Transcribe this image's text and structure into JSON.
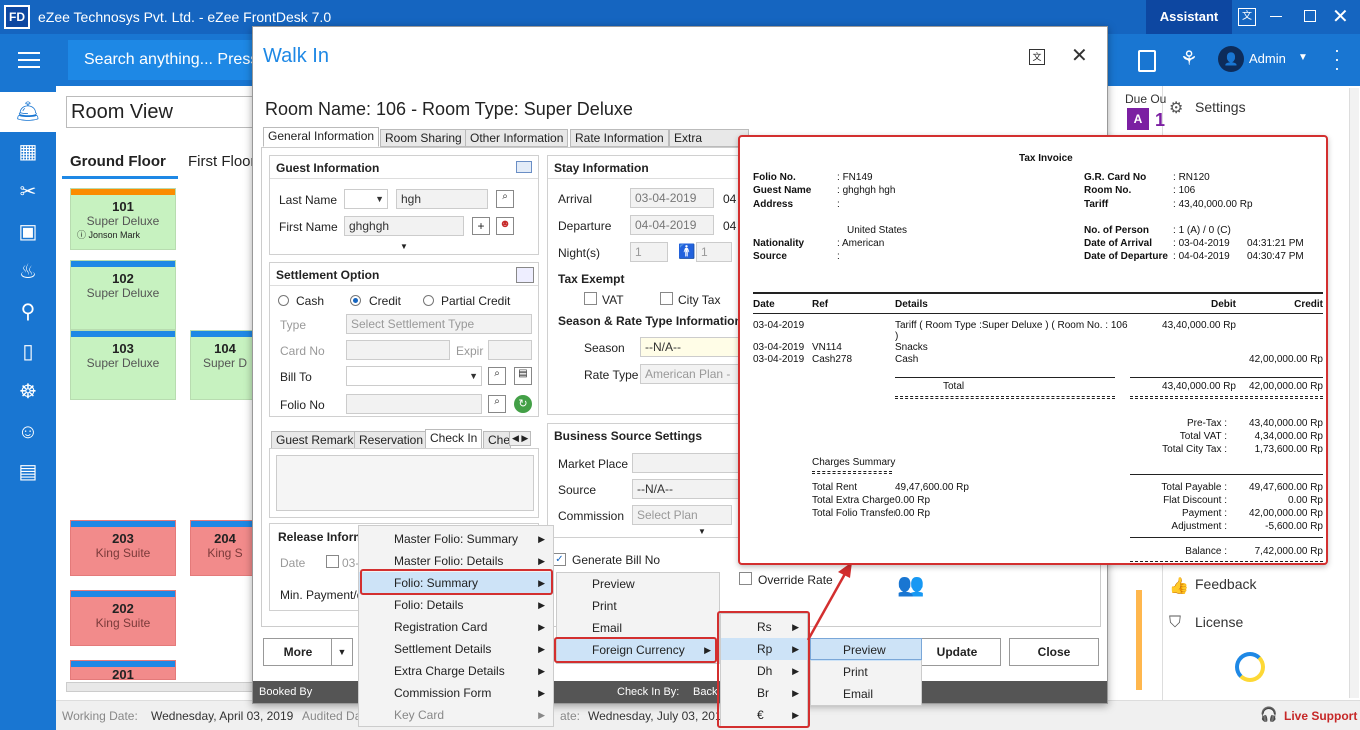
{
  "app": {
    "logo": "FD",
    "title": "eZee Technosys Pvt. Ltd. - eZee FrontDesk 7.0",
    "assistant": "Assistant",
    "search_placeholder": "Search anything... Press",
    "admin": "Admin"
  },
  "room_view": {
    "title": "Room View",
    "floors": [
      "Ground Floor",
      "First Floor"
    ],
    "rooms": [
      {
        "num": "101",
        "type": "Super Deluxe",
        "guest": "Jonson Mark"
      },
      {
        "num": "102",
        "type": "Super Deluxe"
      },
      {
        "num": "103",
        "type": "Super Deluxe"
      },
      {
        "num": "104",
        "type": "Super D"
      },
      {
        "num": "203",
        "type": "King Suite"
      },
      {
        "num": "204",
        "type": "King S"
      },
      {
        "num": "202",
        "type": "King Suite"
      },
      {
        "num": "201",
        "type": ""
      }
    ]
  },
  "right_panel": {
    "due_out": "Due Ou",
    "due_count": "1",
    "settings": "Settings",
    "feedback": "Feedback",
    "license": "License",
    "live_support": "Live Support"
  },
  "status": {
    "working_date_label": "Working Date:",
    "working_date": "Wednesday, April 03, 2019",
    "audited_label": "Audited Da",
    "audited_date": "Wednesday, July 03, 2019",
    "audited_prefix": "ate:"
  },
  "dialog": {
    "title": "Walk In",
    "room_heading": "Room Name: 106 - Room Type: Super Deluxe",
    "tabs": [
      "General Information",
      "Room Sharing",
      "Other Information",
      "Rate Information",
      "Extra Charge"
    ],
    "guest_info": {
      "heading": "Guest Information",
      "last_name_label": "Last Name",
      "last_name": "hgh",
      "first_name_label": "First Name",
      "first_name": "ghghgh"
    },
    "settlement": {
      "heading": "Settlement Option",
      "cash": "Cash",
      "credit": "Credit",
      "partial": "Partial Credit",
      "type_label": "Type",
      "type_placeholder": "Select Settlement Type",
      "card_label": "Card No",
      "expir": "Expir",
      "bill_to": "Bill To",
      "folio_no": "Folio No"
    },
    "remark_tabs": [
      "Guest Remark",
      "Reservation",
      "Check In",
      "Che"
    ],
    "release": {
      "heading": "Release Informa",
      "date_label": "Date",
      "date_value": "03-",
      "min_payment": "Min. Payment/d"
    },
    "stay": {
      "heading": "Stay Information",
      "arrival_label": "Arrival",
      "arrival": "03-04-2019",
      "arrival_time": "04",
      "departure_label": "Departure",
      "departure": "04-04-2019",
      "departure_time": "04",
      "nights_label": "Night(s)",
      "nights": "1",
      "pax": "1",
      "tax_exempt": "Tax Exempt",
      "vat": "VAT",
      "city_tax": "City Tax",
      "season_heading": "Season & Rate Type Information",
      "season_label": "Season",
      "season": "--N/A--",
      "rate_type_label": "Rate Type",
      "rate_type": "American Plan -G"
    },
    "business": {
      "heading": "Business Source Settings",
      "market_label": "Market Place",
      "source_label": "Source",
      "source": "--N/A--",
      "commission_label": "Commission",
      "commission": "Select Plan"
    },
    "generate_bill": "Generate Bill No",
    "override_rate": "Override Rate",
    "buttons": {
      "more": "More",
      "update": "Update",
      "close": "Close"
    },
    "footer": {
      "booked_by": "Booked By",
      "check_in_by": "Check In By:",
      "back": "Back"
    }
  },
  "context_menu": {
    "items": [
      "Master Folio: Summary",
      "Master Folio: Details",
      "Folio: Summary",
      "Folio: Details",
      "Registration Card",
      "Settlement Details",
      "Extra Charge Details",
      "Commission Form",
      "Key Card"
    ]
  },
  "submenu1": {
    "items": [
      "Preview",
      "Print",
      "Email",
      "Foreign Currency"
    ]
  },
  "currency_menu": {
    "items": [
      "Rs",
      "Rp",
      "Dh",
      "Br",
      "€"
    ]
  },
  "submenu3": {
    "items": [
      "Preview",
      "Print",
      "Email"
    ]
  },
  "invoice": {
    "title": "Tax Invoice",
    "left": [
      {
        "k": "Folio No.",
        "v": "FN149"
      },
      {
        "k": "Guest Name",
        "v": "ghghgh hgh"
      },
      {
        "k": "Address",
        "v": ""
      }
    ],
    "country": "United States",
    "left2": [
      {
        "k": "Nationality",
        "v": "American"
      },
      {
        "k": "Source",
        "v": ""
      }
    ],
    "right": [
      {
        "k": "G.R. Card No",
        "v": "RN120"
      },
      {
        "k": "Room No.",
        "v": "106"
      },
      {
        "k": "Tariff",
        "v": "43,40,000.00 Rp"
      }
    ],
    "right2": [
      {
        "k": "No. of Person",
        "v": "1 (A) / 0 (C)"
      },
      {
        "k": "Date of Arrival",
        "v": "03-04-2019",
        "t": "04:31:21 PM"
      },
      {
        "k": "Date of Departure",
        "v": "04-04-2019",
        "t": "04:30:47 PM"
      }
    ],
    "cols": [
      "Date",
      "Ref",
      "Details",
      "Debit",
      "Credit"
    ],
    "rows": [
      {
        "date": "03-04-2019",
        "ref": "",
        "details": "Tariff ( Room Type :Super Deluxe ) ( Room No. : 106",
        "details2": ")",
        "debit": "43,40,000.00 Rp",
        "credit": ""
      },
      {
        "date": "03-04-2019",
        "ref": "VN114",
        "details": "Snacks",
        "debit": "",
        "credit": ""
      },
      {
        "date": "03-04-2019",
        "ref": "Cash278",
        "details": "Cash",
        "debit": "",
        "credit": "42,00,000.00 Rp"
      }
    ],
    "total_label": "Total",
    "total_debit": "43,40,000.00 Rp",
    "total_credit": "42,00,000.00 Rp",
    "taxes": [
      {
        "k": "Pre-Tax :",
        "v": "43,40,000.00 Rp"
      },
      {
        "k": "Total VAT :",
        "v": "4,34,000.00 Rp"
      },
      {
        "k": "Total City Tax :",
        "v": "1,73,600.00 Rp"
      }
    ],
    "charges_heading": "Charges Summary",
    "charges": [
      {
        "k": "Total Rent",
        "v": "49,47,600.00 Rp"
      },
      {
        "k": "Total Extra Charge",
        "v": "0.00 Rp"
      },
      {
        "k": "Total Folio Transfer",
        "v": "0.00 Rp"
      }
    ],
    "payable": [
      {
        "k": "Total Payable :",
        "v": "49,47,600.00 Rp"
      },
      {
        "k": "Flat Discount :",
        "v": "0.00 Rp"
      },
      {
        "k": "Payment :",
        "v": "42,00,000.00 Rp"
      },
      {
        "k": "Adjustment :",
        "v": "-5,600.00 Rp"
      }
    ],
    "balance_label": "Balance :",
    "balance": "7,42,000.00 Rp"
  }
}
